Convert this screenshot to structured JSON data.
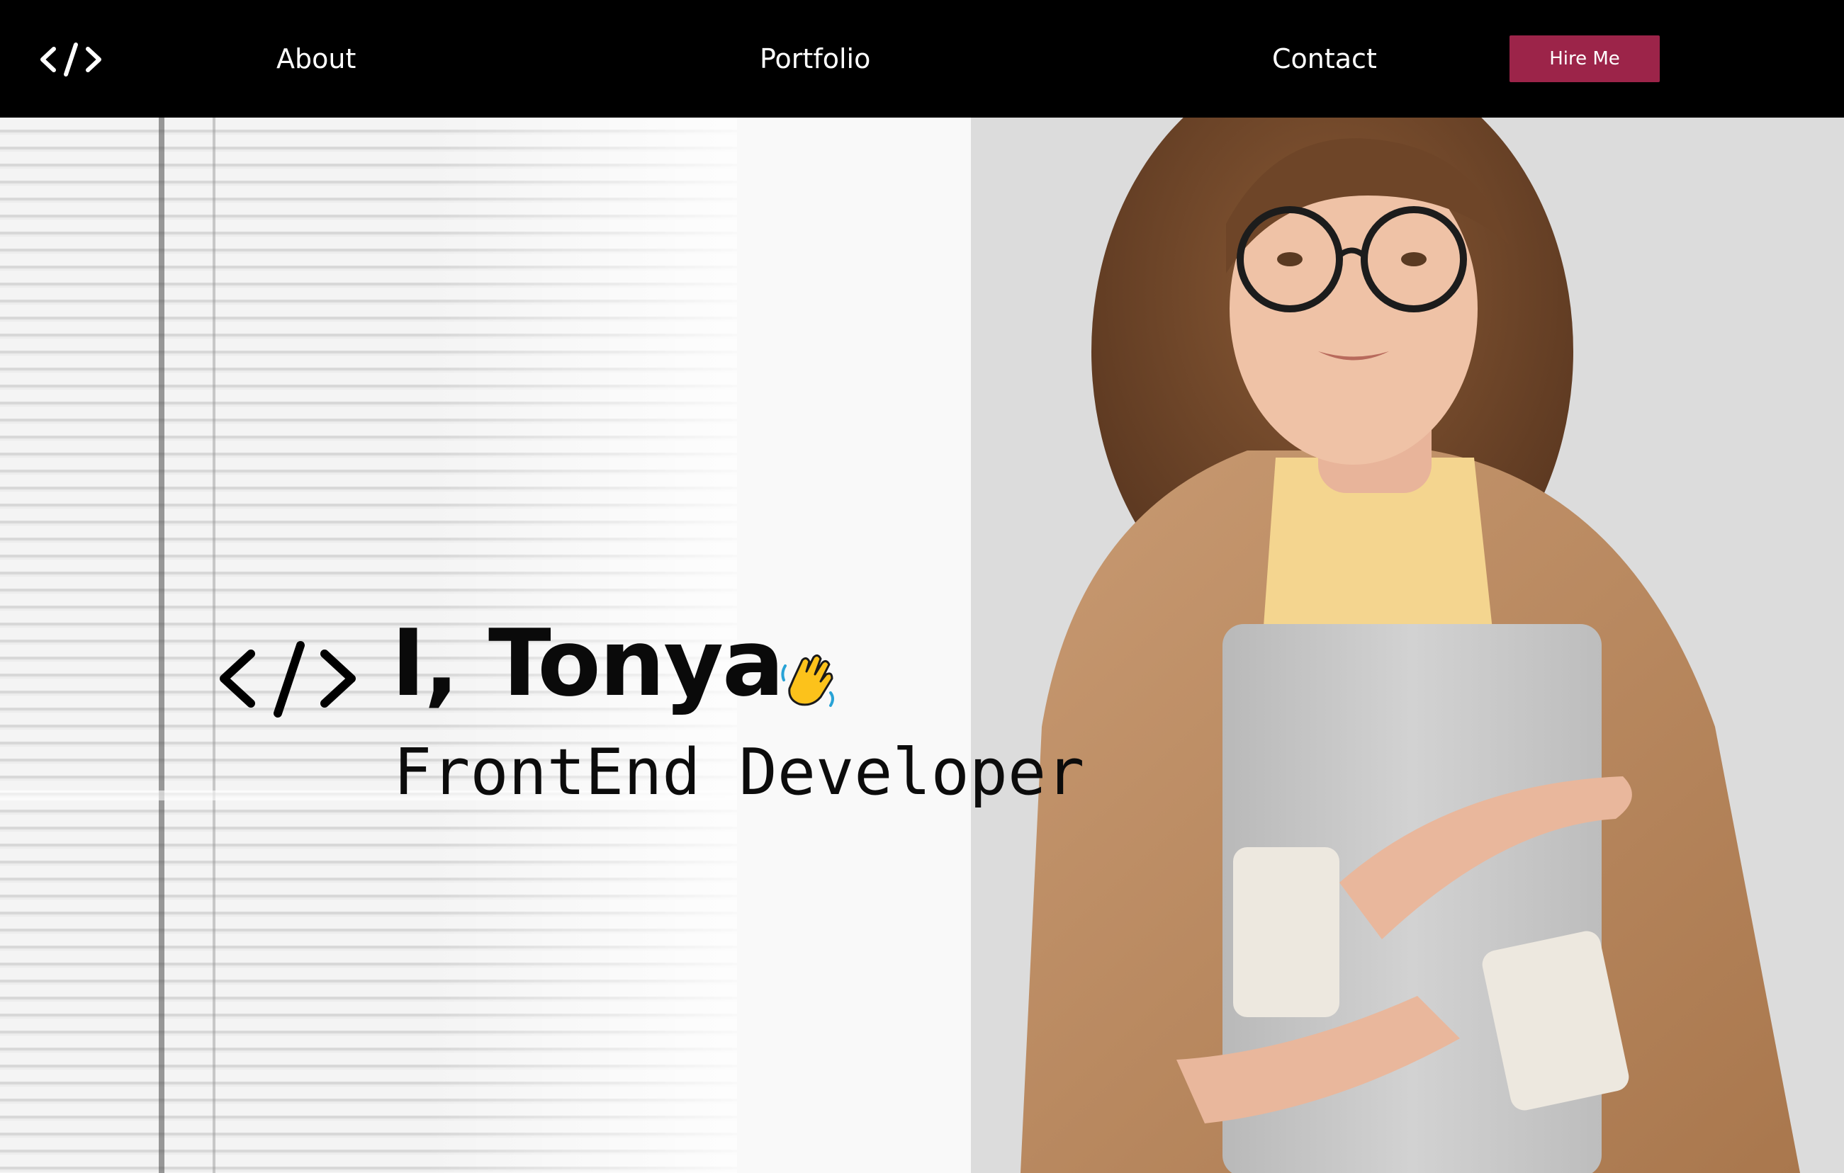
{
  "nav": {
    "logo_icon": "code-brackets-icon",
    "links": [
      {
        "label": "About"
      },
      {
        "label": "Portfolio"
      },
      {
        "label": "Contact"
      }
    ],
    "hire_label": "Hire Me"
  },
  "hero": {
    "code_icon": "code-brackets-icon",
    "title": "I, Tonya",
    "wave_icon": "waving-hand-icon",
    "subtitle": "FrontEnd Developer",
    "background_image": "woman-with-glasses-holding-laptop-by-window-blinds"
  },
  "colors": {
    "nav_background": "#000000",
    "accent": "#9c2449",
    "nav_text": "#ffffff",
    "hero_text": "#0a0a0a"
  }
}
